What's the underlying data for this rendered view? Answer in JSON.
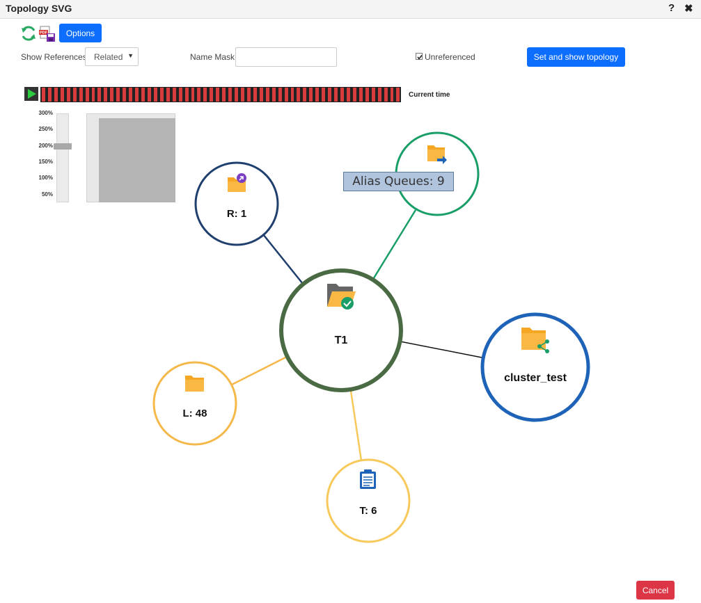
{
  "window": {
    "title": "Topology SVG",
    "help_label": "?",
    "close_label": "✖"
  },
  "toolbar": {
    "refresh_icon": "refresh-icon",
    "pdf_icon": "pdf-export-icon",
    "options_label": "Options",
    "show_references_label": "Show References:",
    "show_references_value": "Related",
    "name_mask_label": "Name Mask:",
    "name_mask_value": "",
    "unreferenced_label": "Unreferenced",
    "unreferenced_checked": true,
    "set_show_label": "Set and show topology"
  },
  "timeline": {
    "current_time_label": "Current time"
  },
  "zoom": {
    "levels": [
      "300%",
      "250%",
      "200%",
      "150%",
      "100%",
      "50%"
    ],
    "current": "200%"
  },
  "graph": {
    "center": {
      "label": "T1",
      "color": "#4a6a44",
      "icon": "folder-check-icon"
    },
    "nodes": [
      {
        "key": "r",
        "label": "R: 1",
        "color": "#1f3f6e",
        "icon": "folder-remote-icon"
      },
      {
        "key": "alias",
        "label": "",
        "color": "#1a9e68",
        "icon": "folder-alias-icon"
      },
      {
        "key": "cluster",
        "label": "cluster_test",
        "color": "#1e63b8",
        "icon": "folder-share-icon"
      },
      {
        "key": "l",
        "label": "L: 48",
        "color": "#f5b84a",
        "icon": "folder-local-icon"
      },
      {
        "key": "t",
        "label": "T: 6",
        "color": "#f7c85a",
        "icon": "topic-doc-icon"
      }
    ],
    "tooltip": "Alias Queues: 9"
  },
  "footer": {
    "cancel_label": "Cancel"
  }
}
